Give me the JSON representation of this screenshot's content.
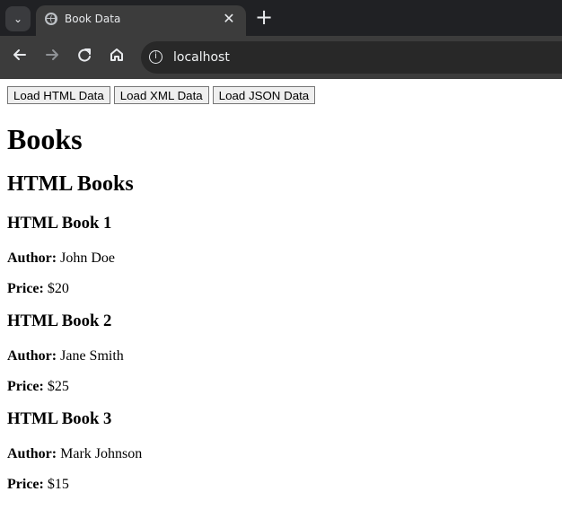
{
  "browser": {
    "tab_title": "Book Data",
    "address": "localhost",
    "close_symbol": "✕",
    "new_tab_symbol": "+",
    "tab_search_symbol": "⌄"
  },
  "controls": {
    "load_html": "Load HTML Data",
    "load_xml": "Load XML Data",
    "load_json": "Load JSON Data"
  },
  "page": {
    "title": "Books",
    "section_title": "HTML Books",
    "author_label": "Author:",
    "price_label": "Price:",
    "books": [
      {
        "title": "HTML Book 1",
        "author": "John Doe",
        "price": "$20"
      },
      {
        "title": "HTML Book 2",
        "author": "Jane Smith",
        "price": "$25"
      },
      {
        "title": "HTML Book 3",
        "author": "Mark Johnson",
        "price": "$15"
      }
    ]
  },
  "icons": {
    "tab": "globe-icon",
    "back": "back-arrow-icon",
    "forward": "forward-arrow-icon",
    "reload": "reload-icon",
    "home": "home-icon",
    "site_info": "info-icon"
  },
  "colors": {
    "browser_tab_strip": "#202124",
    "browser_toolbar": "#3c3c3c",
    "address_bar": "#282828",
    "page_background": "#ffffff",
    "button_background": "#efefef"
  }
}
